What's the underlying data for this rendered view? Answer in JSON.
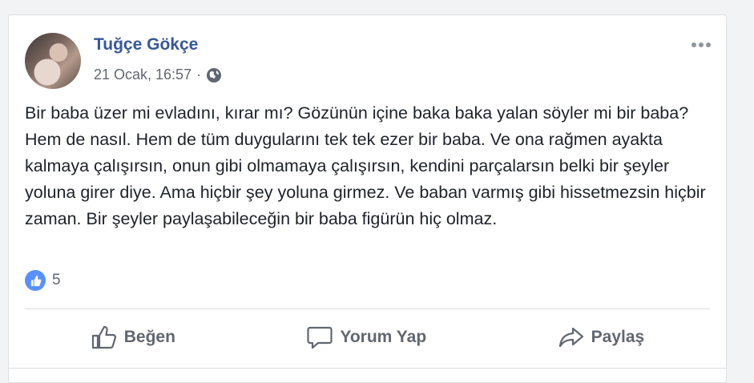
{
  "post": {
    "author": "Tuğçe Gökçe",
    "date": "21 Ocak, 16:57",
    "separator": "·",
    "privacy_icon": "globe-icon",
    "text": "Bir baba üzer mi evladını, kırar mı? Gözünün içine baka baka yalan söyler mi bir baba? Hem de nasıl. Hem de tüm duygularını tek tek ezer bir baba. Ve ona rağmen ayakta kalmaya çalışırsın, onun gibi olmamaya çalışırsın, kendini parçalarsın belki bir şeyler yoluna girer diye. Ama hiçbir şey yoluna girmez. Ve baban varmış gibi hissetmezsin hiçbir zaman. Bir şeyler paylaşabileceğin bir baba figürün hiç olmaz.",
    "reaction_count": "5",
    "reaction_icon": "like-icon"
  },
  "actions": {
    "like": "Beğen",
    "comment": "Yorum Yap",
    "share": "Paylaş"
  },
  "colors": {
    "author": "#365899",
    "meta": "#616770",
    "text": "#1d2129",
    "like_badge": "#5890ff",
    "action": "#606770"
  }
}
